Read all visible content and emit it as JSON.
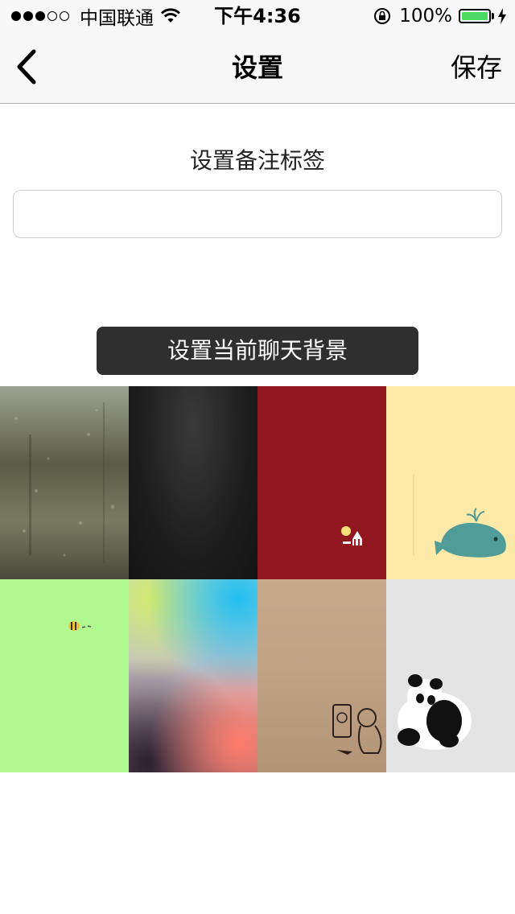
{
  "status_bar": {
    "carrier": "中国联通",
    "time": "下午4:36",
    "battery_percent": "100%",
    "battery_level": 1.0,
    "battery_color": "#4cd964"
  },
  "nav": {
    "back_icon": "chevron-left-icon",
    "title": "设置",
    "save_label": "保存"
  },
  "remark": {
    "title": "设置备注标签",
    "value": "",
    "placeholder": ""
  },
  "background": {
    "header": "设置当前聊天背景",
    "header_bg": "#2f2f2f",
    "options": [
      {
        "name": "water-droplets-wallpaper"
      },
      {
        "name": "dark-texture-wallpaper"
      },
      {
        "name": "red-circus-wallpaper"
      },
      {
        "name": "yellow-whale-wallpaper"
      },
      {
        "name": "green-bee-wallpaper"
      },
      {
        "name": "blurred-gradient-wallpaper"
      },
      {
        "name": "kraft-paper-wallpaper"
      },
      {
        "name": "panda-wallpaper"
      }
    ]
  }
}
